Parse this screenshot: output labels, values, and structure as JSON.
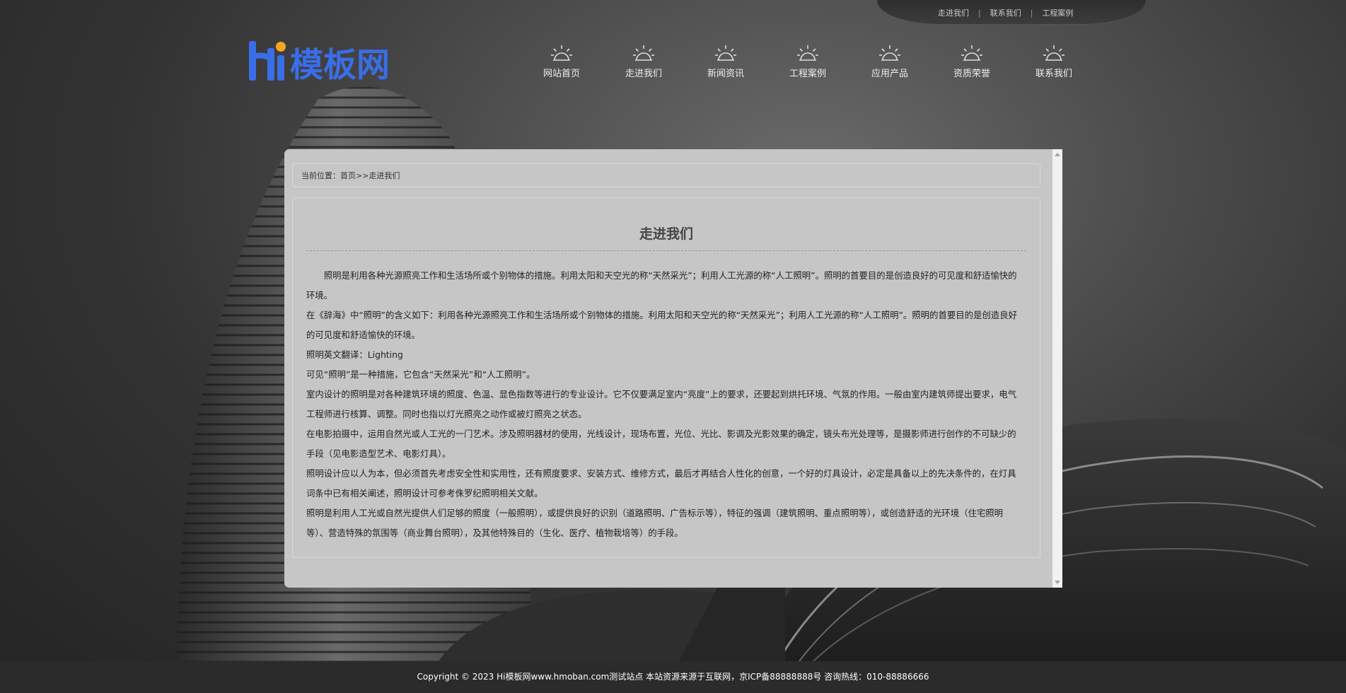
{
  "top_links": [
    "走进我们",
    "联系我们",
    "工程案例"
  ],
  "logo": {
    "text": "模板网",
    "colors": {
      "hi": "#3a6ee8",
      "dot": "#f5a623"
    }
  },
  "nav": [
    {
      "label": "网站首页",
      "icon": "lamp-icon"
    },
    {
      "label": "走进我们",
      "icon": "lamp-icon"
    },
    {
      "label": "新闻资讯",
      "icon": "lamp-icon"
    },
    {
      "label": "工程案例",
      "icon": "lamp-icon"
    },
    {
      "label": "应用产品",
      "icon": "lamp-icon"
    },
    {
      "label": "资质荣誉",
      "icon": "lamp-icon"
    },
    {
      "label": "联系我们",
      "icon": "lamp-icon"
    }
  ],
  "breadcrumb": {
    "prefix": "当前位置：",
    "home": "首页",
    "separator": ">>",
    "current": "走进我们"
  },
  "content": {
    "title": "走进我们",
    "paragraphs": [
      "照明是利用各种光源照亮工作和生活场所或个别物体的措施。利用太阳和天空光的称“天然采光”；利用人工光源的称“人工照明”。照明的首要目的是创造良好的可见度和舒适愉快的环境。",
      "在《辞海》中“照明”的含义如下：利用各种光源照亮工作和生活场所或个别物体的措施。利用太阳和天空光的称“天然采光”；利用人工光源的称“人工照明”。照明的首要目的是创造良好的可见度和舒适愉快的环境。",
      "照明英文翻译：Lighting",
      "可见“照明”是一种措施，它包含“天然采光”和“人工照明”。",
      "室内设计的照明是对各种建筑环境的照度、色温、显色指数等进行的专业设计。它不仅要满足室内“亮度”上的要求，还要起到烘托环境、气氛的作用。一般由室内建筑师提出要求，电气工程师进行核算、调整。同时也指以灯光照亮之动作或被灯照亮之状态。",
      "在电影拍摄中，运用自然光或人工光的一门艺术。涉及照明器材的使用，光线设计，现场布置，光位、光比、影调及光影效果的确定，镜头布光处理等，是摄影师进行创作的不可缺少的手段（见电影造型艺术、电影灯具）。",
      "照明设计应以人为本，但必须首先考虑安全性和实用性，还有照度要求、安装方式、维修方式，最后才再结合人性化的创意，一个好的灯具设计，必定是具备以上的先决条件的，在灯具词条中已有相关阐述，照明设计可参考侏罗纪照明相关文献。",
      "照明是利用人工光或自然光提供人们足够的照度（一般照明），或提供良好的识别（道路照明、广告标示等），特征的强调（建筑照明、重点照明等），或创造舒适的光环境（住宅照明等）、营造特殊的氛围等（商业舞台照明），及其他特殊目的（生化、医疗、植物栽培等）的手段。"
    ]
  },
  "footer": {
    "text": "Copyright © 2023 Hi模板网www.hmoban.com测试站点 本站资源来源于互联网，京ICP备88888888号 咨询热线：010-88886666"
  }
}
